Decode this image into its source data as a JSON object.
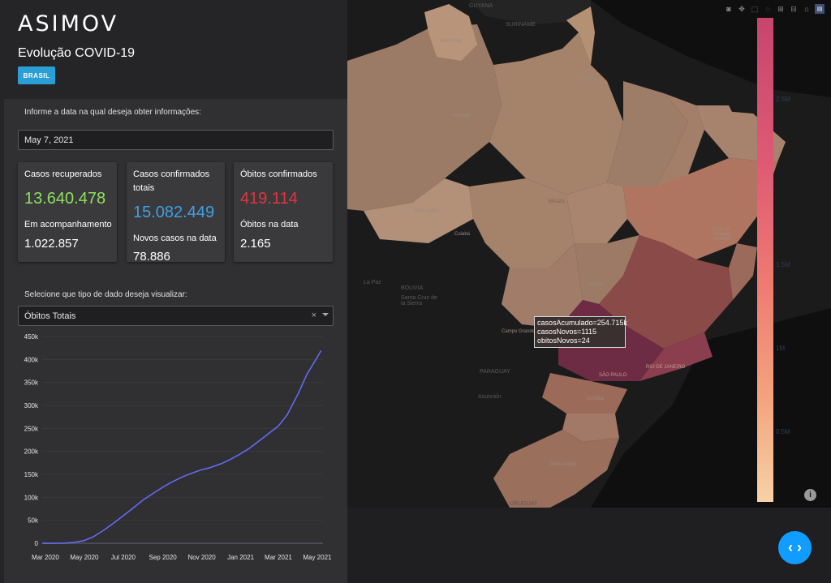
{
  "header": {
    "brand": "ASIMOV",
    "subtitle": "Evolução COVID-19",
    "country_button": "BRASIL"
  },
  "date_picker": {
    "label": "Informe a data na qual deseja obter informações:",
    "value": "May 7, 2021"
  },
  "cards": {
    "recovered": {
      "label": "Casos recuperados",
      "value": "13.640.478",
      "sub_label": "Em acompanhamento",
      "sub_value": "1.022.857",
      "color": "#8fe05e"
    },
    "confirmed": {
      "label": "Casos confirmados totais",
      "value": "15.082.449",
      "sub_label": "Novos casos na data",
      "sub_value": "78.886",
      "color": "#3ea0e4"
    },
    "deaths": {
      "label": "Óbitos confirmados",
      "value": "419.114",
      "sub_label": "Óbitos na data",
      "sub_value": "2.165",
      "color": "#e3343f"
    }
  },
  "data_select": {
    "label": "Selecione que tipo de dado deseja visualizar:",
    "selected": "Óbitos Totais",
    "clear": "×"
  },
  "chart_data": {
    "type": "line",
    "ylim": [
      0,
      450000
    ],
    "y_ticks": [
      0,
      50000,
      100000,
      150000,
      200000,
      250000,
      300000,
      350000,
      400000,
      450000
    ],
    "y_tick_labels": [
      "0",
      "50k",
      "100k",
      "150k",
      "200k",
      "250k",
      "300k",
      "350k",
      "400k",
      "450k"
    ],
    "x_tick_labels": [
      "Mar 2020",
      "May 2020",
      "Jul 2020",
      "Sep 2020",
      "Nov 2020",
      "Jan 2021",
      "Mar 2021",
      "May 2021"
    ],
    "x_tick_dates": [
      "2020-03-01",
      "2020-05-01",
      "2020-07-01",
      "2020-09-01",
      "2020-11-01",
      "2021-01-01",
      "2021-03-01",
      "2021-05-01"
    ],
    "xlim": [
      "2020-02-25",
      "2021-05-10"
    ],
    "color": "#636efa",
    "series": [
      {
        "x": [
          "2020-02-25",
          "2020-03-20",
          "2020-04-01",
          "2020-04-15",
          "2020-05-01",
          "2020-05-15",
          "2020-06-01",
          "2020-06-15",
          "2020-07-01",
          "2020-07-15",
          "2020-08-01",
          "2020-08-15",
          "2020-09-01",
          "2020-09-15",
          "2020-10-01",
          "2020-10-15",
          "2020-11-01",
          "2020-11-15",
          "2020-12-01",
          "2020-12-15",
          "2021-01-01",
          "2021-01-15",
          "2021-02-01",
          "2021-02-15",
          "2021-03-01",
          "2021-03-15",
          "2021-04-01",
          "2021-04-15",
          "2021-05-01",
          "2021-05-07"
        ],
        "values": [
          0,
          0,
          300,
          1900,
          6000,
          14000,
          29000,
          43000,
          60000,
          75000,
          94000,
          107000,
          122000,
          133000,
          144000,
          152000,
          160000,
          165000,
          173000,
          182000,
          195000,
          207000,
          225000,
          240000,
          255000,
          280000,
          325000,
          368000,
          405000,
          419114
        ]
      }
    ]
  },
  "map": {
    "toolbar_icons": [
      "camera-icon",
      "pan-icon",
      "box-select-icon",
      "lasso-icon",
      "zoom-in-icon",
      "zoom-out-icon",
      "home-icon",
      "plotly-logo-icon"
    ],
    "colorbar_ticks": [
      "2.5M",
      "1.5M",
      "1M",
      "0.5M"
    ],
    "colorscale": [
      "#c8456e",
      "#de5a74",
      "#ef7a72",
      "#f3a27e",
      "#f6d2a6"
    ],
    "tooltip": {
      "line1": "casosAcumulado=254.715k",
      "line2": "casosNovos=1115",
      "line3": "obitosNovos=24"
    },
    "labels": {
      "guyana": "GUYANA",
      "suriname": "SURINAME",
      "brazil": "BRAZIL",
      "bolivia": "BOLIVIA",
      "paraguay": "PARAGUAY",
      "uruguay": "URUGUAY",
      "sao_paulo": "SÃO PAULO",
      "rio": "RIO DE JANEIRO",
      "boa_vista": "Boa Vista",
      "manaus": "Manaus",
      "belem": "Belém",
      "porto_velho": "Porto Velho",
      "cuiaba": "Cuiabá",
      "goiania": "Goiânia",
      "curitiba": "Curitiba",
      "porto_alegre": "Porto Alegre",
      "campo_grande": "Campo Grande",
      "salvador": "Feira de Santana Salvador",
      "la_paz": "La Paz",
      "santa_cruz": "Santa Cruz de la Sierra",
      "asuncion": "Asunción"
    }
  },
  "code_button": "‹ ›"
}
